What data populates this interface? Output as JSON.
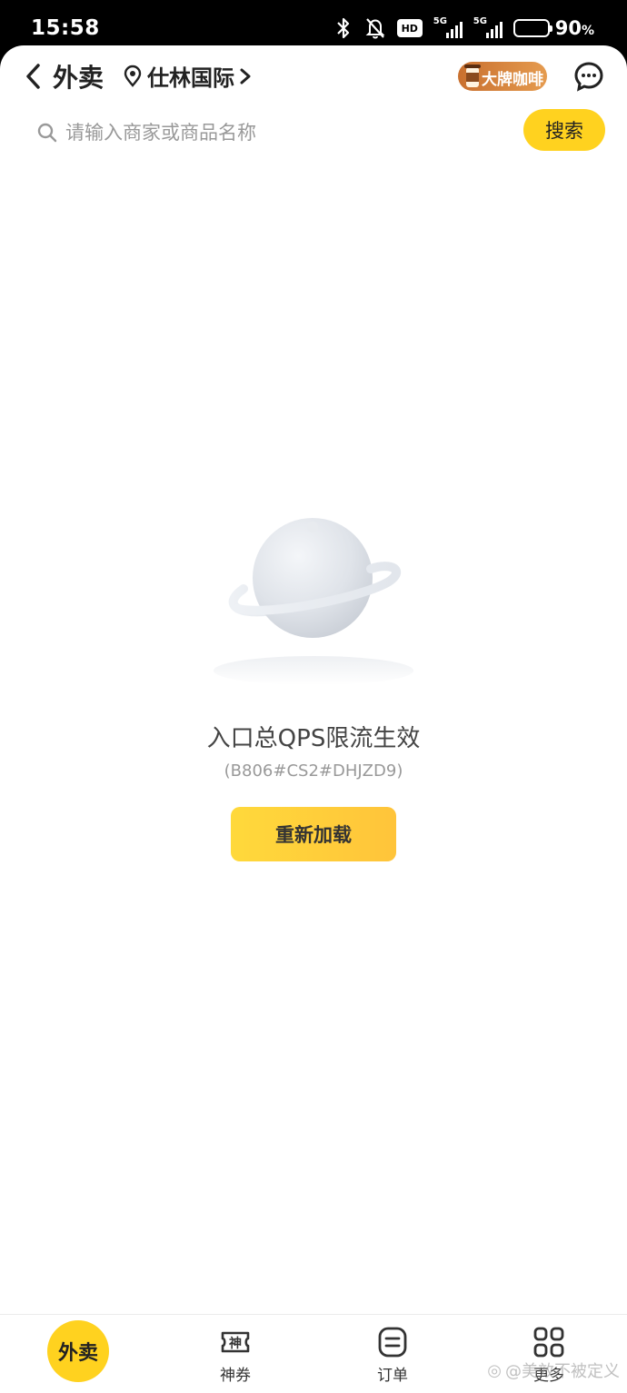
{
  "status_bar": {
    "time": "15:58",
    "battery_percent": "90",
    "battery_percent_sign": "%",
    "battery_level": 0.9,
    "hd_label": "HD",
    "signal1_label": "5G",
    "signal2_label": "5G"
  },
  "header": {
    "title": "外卖",
    "location": "仕林国际",
    "promo_label": "大牌咖啡"
  },
  "search": {
    "placeholder": "请输入商家或商品名称",
    "button_label": "搜索"
  },
  "error": {
    "title": "入口总QPS限流生效",
    "code": "(B806#CS2#DHJZD9)",
    "reload_label": "重新加载"
  },
  "tabbar": {
    "home_label": "外卖",
    "coupon_label": "神券",
    "coupon_icon_text": "神",
    "orders_label": "订单",
    "more_label": "更多"
  },
  "watermark": "@美效不被定义",
  "colors": {
    "accent": "#ffd21f",
    "text": "#222222",
    "muted": "#999999"
  }
}
